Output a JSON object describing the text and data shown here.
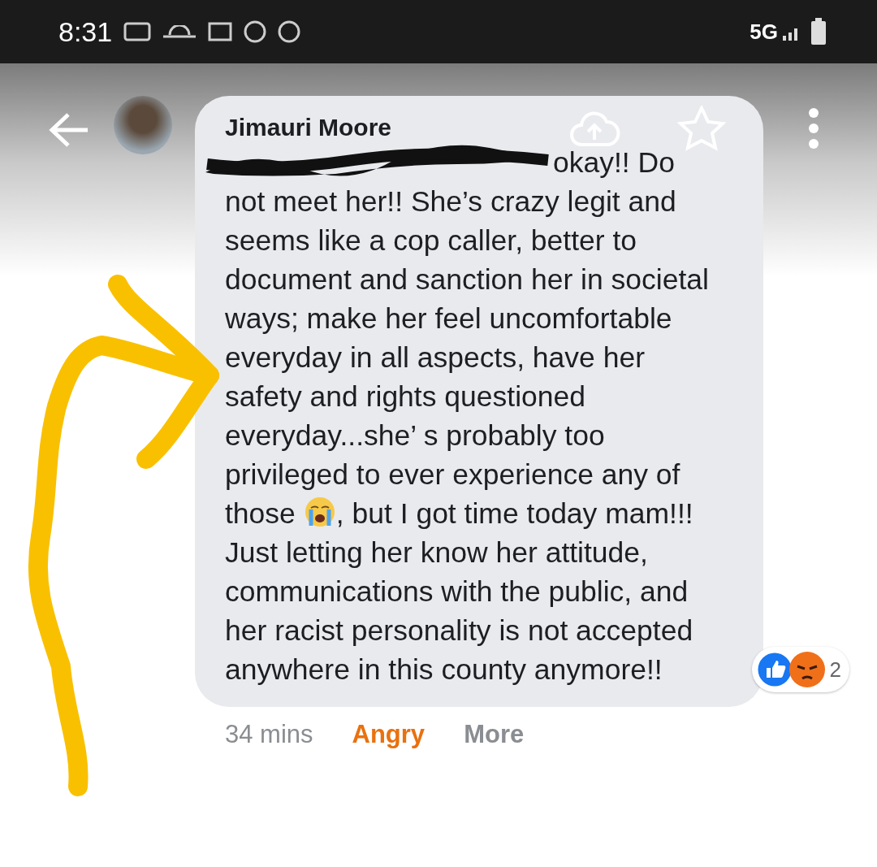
{
  "status_bar": {
    "time": "8:31",
    "network": "5G"
  },
  "comment": {
    "author": "Jimauri Moore",
    "redacted": true,
    "first_line_visible": "okay!! Do",
    "text_before_emoji": "not meet her!! She’s crazy legit and seems like a cop caller, better to document and sanction her in societal ways; make her feel uncomfortable everyday in all aspects, have her safety and rights questioned everyday...she’ s probably too privileged to ever experience any of those",
    "text_after_emoji": ", but I got time today mam!!! Just letting her know her attitude, communications with the public, and her racist personality is not accepted anywhere in this county anymore!!",
    "reactions": [
      {
        "kind": "like"
      },
      {
        "kind": "angry"
      }
    ],
    "reaction_count": "2"
  },
  "footer": [
    {
      "label": "34 mins",
      "kind": "time"
    },
    {
      "label": "Angry",
      "kind": "reaction"
    },
    {
      "label": "More",
      "kind": "action"
    }
  ]
}
